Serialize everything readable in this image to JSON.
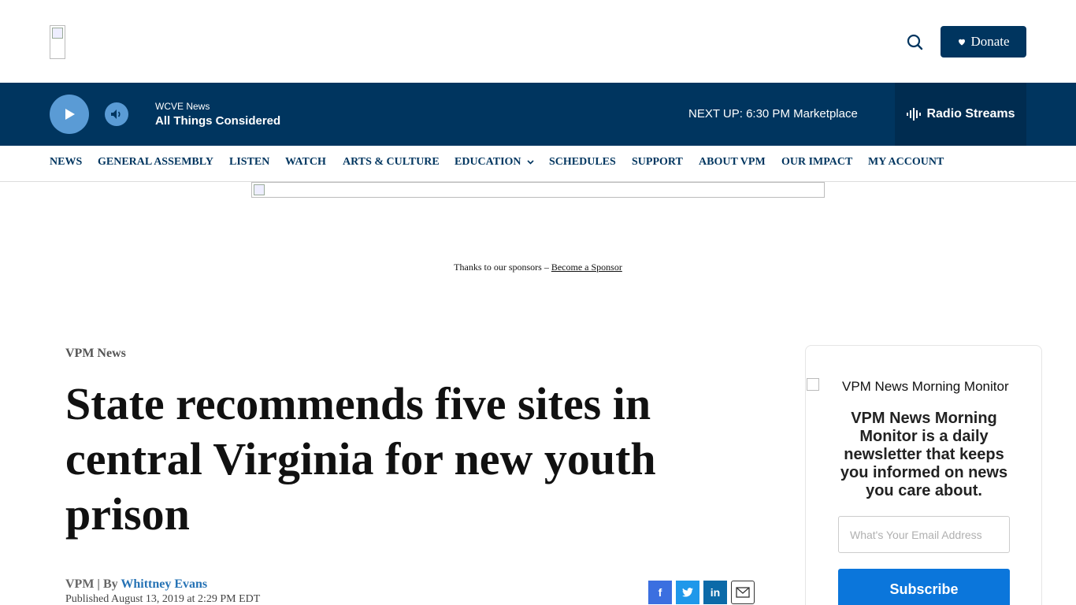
{
  "header": {
    "search_icon": "search-icon",
    "donate_label": "Donate",
    "donate_icon": "heart-icon"
  },
  "player": {
    "station": "WCVE News",
    "program": "All Things Considered",
    "next_up": "NEXT UP: 6:30 PM Marketplace",
    "streams_label": "Radio Streams"
  },
  "nav": {
    "items": [
      "NEWS",
      "GENERAL ASSEMBLY",
      "LISTEN",
      "WATCH",
      "ARTS & CULTURE",
      "EDUCATION",
      "SCHEDULES",
      "SUPPORT",
      "ABOUT VPM",
      "OUR IMPACT",
      "MY ACCOUNT"
    ]
  },
  "sponsor": {
    "text": "Thanks to our sponsors – ",
    "link": "Become a Sponsor"
  },
  "article": {
    "kicker": "VPM News",
    "headline": "State recommends five sites in central Virginia for new youth prison",
    "source": "VPM | By ",
    "author": "Whittney Evans",
    "published": "Published August 13, 2019 at 2:29 PM EDT"
  },
  "share": {
    "facebook": "f",
    "twitter": "twitter-icon",
    "linkedin": "in",
    "email": "email-icon"
  },
  "newsletter": {
    "image_alt": "VPM News Morning Monitor",
    "description": "VPM News Morning Monitor is a daily newsletter that keeps you informed on news you care about.",
    "email_placeholder": "What's Your Email Address",
    "subscribe_label": "Subscribe"
  },
  "colors": {
    "brand_navy": "#00355f",
    "player_accent": "#5a9bd5",
    "subscribe_blue": "#0b76db",
    "facebook": "#3b6fe0",
    "twitter": "#1f98ea",
    "linkedin": "#0b6aa8"
  }
}
